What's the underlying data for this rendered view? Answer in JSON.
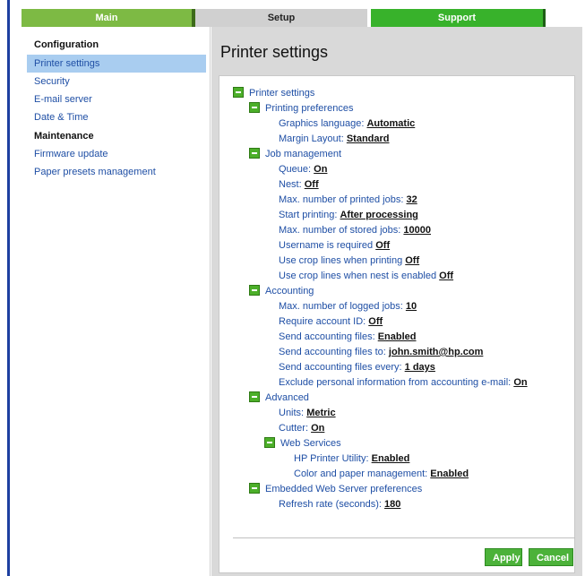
{
  "colors": {
    "accent": "#38b22b",
    "link": "#1f4fa5",
    "selected": "#a9cdf0",
    "panel_bg": "#d9d9d9"
  },
  "tabs": [
    {
      "label": "Main"
    },
    {
      "label": "Setup"
    },
    {
      "label": "Support"
    }
  ],
  "sidebar": {
    "items": [
      {
        "label": "Configuration",
        "type": "heading"
      },
      {
        "label": "Printer settings",
        "type": "link",
        "selected": true
      },
      {
        "label": "Security",
        "type": "link"
      },
      {
        "label": "E-mail server",
        "type": "link"
      },
      {
        "label": "Date & Time",
        "type": "link"
      },
      {
        "label": "Maintenance",
        "type": "heading"
      },
      {
        "label": "Firmware update",
        "type": "link"
      },
      {
        "label": "Paper presets management",
        "type": "link"
      }
    ]
  },
  "main": {
    "title": "Printer settings",
    "tree": {
      "root": "Printer settings",
      "printing_preferences": {
        "label": "Printing preferences",
        "graphics_language": {
          "label": "Graphics language:",
          "value": "Automatic"
        },
        "margin_layout": {
          "label": "Margin Layout:",
          "value": "Standard"
        }
      },
      "job_management": {
        "label": "Job management",
        "queue": {
          "label": "Queue:",
          "value": "On"
        },
        "nest": {
          "label": "Nest:",
          "value": "Off"
        },
        "max_printed": {
          "label": "Max. number of printed jobs:",
          "value": "32"
        },
        "start_printing": {
          "label": "Start printing:",
          "value": "After processing"
        },
        "max_stored": {
          "label": "Max. number of stored jobs:",
          "value": "10000"
        },
        "username_required": {
          "label": "Username is required",
          "value": "Off"
        },
        "crop_lines": {
          "label": "Use crop lines when printing",
          "value": "Off"
        },
        "crop_lines_nest": {
          "label": "Use crop lines when nest is enabled",
          "value": "Off"
        }
      },
      "accounting": {
        "label": "Accounting",
        "max_logged": {
          "label": "Max. number of logged jobs:",
          "value": "10"
        },
        "require_account": {
          "label": "Require account ID:",
          "value": "Off"
        },
        "send_files": {
          "label": "Send accounting files:",
          "value": "Enabled"
        },
        "send_to": {
          "label": "Send accounting files to:",
          "value": "john.smith@hp.com"
        },
        "send_every": {
          "label": "Send accounting files every:",
          "value": "1 days"
        },
        "exclude_personal": {
          "label": "Exclude personal information from accounting e-mail:",
          "value": "On"
        }
      },
      "advanced": {
        "label": "Advanced",
        "units": {
          "label": "Units:",
          "value": "Metric"
        },
        "cutter": {
          "label": "Cutter:",
          "value": "On"
        },
        "web_services": {
          "label": "Web Services",
          "hp_utility": {
            "label": "HP Printer Utility:",
            "value": "Enabled"
          },
          "color_paper": {
            "label": "Color and paper management:",
            "value": "Enabled"
          }
        }
      },
      "ews_prefs": {
        "label": "Embedded Web Server preferences",
        "refresh": {
          "label": "Refresh rate (seconds):",
          "value": "180"
        }
      }
    },
    "buttons": {
      "apply": "Apply",
      "cancel": "Cancel"
    }
  }
}
